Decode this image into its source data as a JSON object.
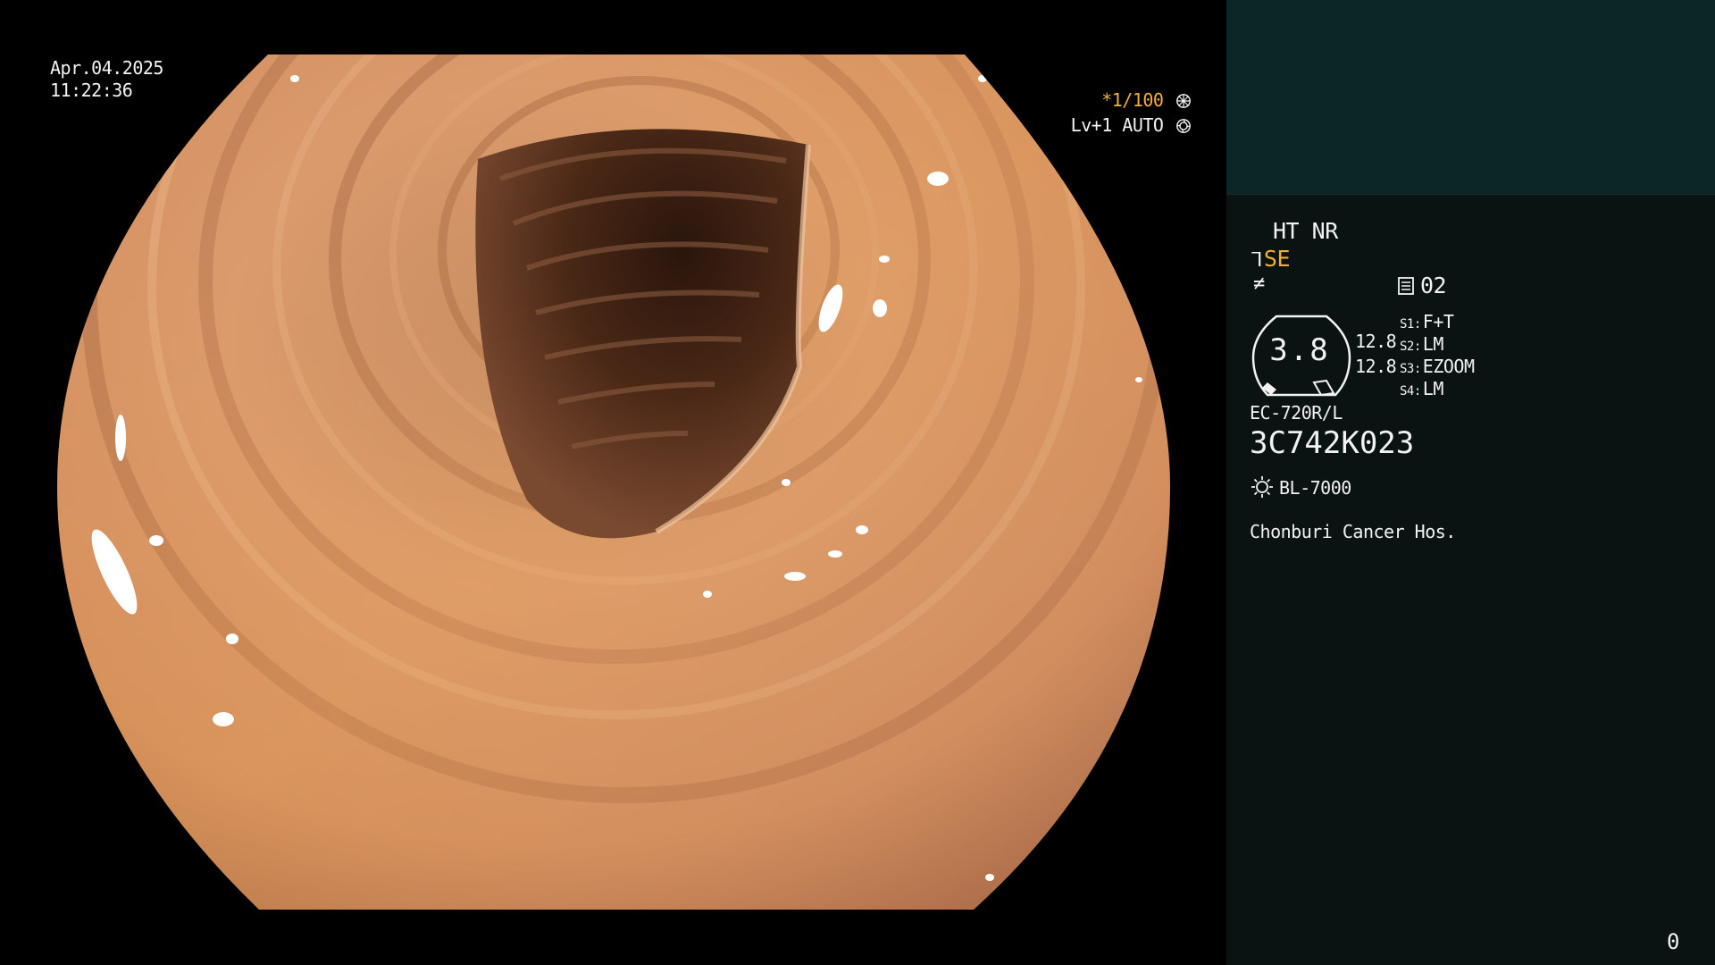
{
  "scope_overlay": {
    "date": "Apr.04.2025",
    "time": "11:22:36",
    "shutter_rate": "*1/100",
    "level_mode": "Lv+1 AUTO"
  },
  "panel": {
    "ht_nr": "HT NR",
    "structure_enhancement": "SE",
    "memo_number": "02",
    "gauge_value": "3.8",
    "gauge_sub_values": [
      "12.8",
      "12.8"
    ],
    "switches": [
      {
        "key": "S1:",
        "value": "F+T"
      },
      {
        "key": "S2:",
        "value": "LM"
      },
      {
        "key": "S3:",
        "value": "EZOOM"
      },
      {
        "key": "S4:",
        "value": "LM"
      }
    ],
    "scope_model": "EC-720R/L",
    "scope_serial": "3C742K023",
    "light_source": "BL-7000",
    "hospital": "Chonburi Cancer Hos.",
    "counter": "0"
  },
  "icons": {
    "shutter": "aperture-icon",
    "auto": "iris-icon",
    "se": "hook-icon",
    "flat": "strike-icon",
    "memo": "memo-icon",
    "light": "lamp-icon"
  },
  "colors": {
    "accent": "#f0b133",
    "text": "#f2f2f2",
    "panel_bg": "#0a1212",
    "thumb_bg": "#0c2527"
  }
}
